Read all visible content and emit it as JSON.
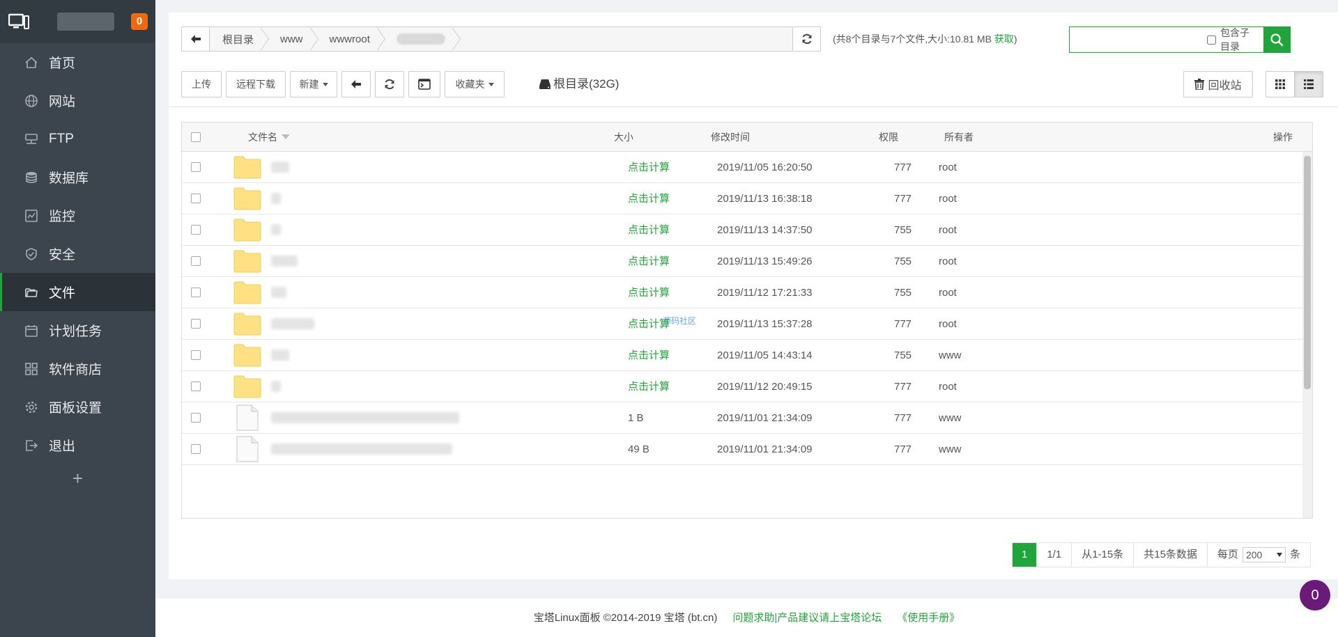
{
  "sidebar": {
    "badge": "0",
    "items": [
      {
        "label": "首页",
        "icon": "home-icon"
      },
      {
        "label": "网站",
        "icon": "globe-icon"
      },
      {
        "label": "FTP",
        "icon": "ftp-icon"
      },
      {
        "label": "数据库",
        "icon": "database-icon"
      },
      {
        "label": "监控",
        "icon": "monitor-icon"
      },
      {
        "label": "安全",
        "icon": "shield-icon"
      },
      {
        "label": "文件",
        "icon": "folder-icon",
        "active": true
      },
      {
        "label": "计划任务",
        "icon": "calendar-icon"
      },
      {
        "label": "软件商店",
        "icon": "grid-icon"
      },
      {
        "label": "面板设置",
        "icon": "gear-icon"
      },
      {
        "label": "退出",
        "icon": "logout-icon"
      }
    ],
    "add": "+"
  },
  "path": {
    "crumbs": [
      "根目录",
      "www",
      "wwwroot"
    ],
    "info_prefix": "(共8个目录与7个文件,大小:10.81 MB ",
    "info_link": "获取",
    "info_suffix": ")"
  },
  "search": {
    "placeholder": "",
    "subdir_label": "包含子目录"
  },
  "toolbar": {
    "upload": "上传",
    "remote_download": "远程下载",
    "new": "新建",
    "favorites": "收藏夹",
    "disk": "根目录(32G)",
    "recycle": "回收站"
  },
  "table": {
    "headers": {
      "name": "文件名",
      "size": "大小",
      "mtime": "修改时间",
      "perm": "权限",
      "owner": "所有者",
      "ops": "操作"
    },
    "rows": [
      {
        "type": "folder",
        "size": "点击计算",
        "mtime": "2019/11/05 16:20:50",
        "perm": "777",
        "owner": "root"
      },
      {
        "type": "folder",
        "size": "点击计算",
        "mtime": "2019/11/13 16:38:18",
        "perm": "777",
        "owner": "root"
      },
      {
        "type": "folder",
        "size": "点击计算",
        "mtime": "2019/11/13 14:37:50",
        "perm": "755",
        "owner": "root"
      },
      {
        "type": "folder",
        "size": "点击计算",
        "mtime": "2019/11/13 15:49:26",
        "perm": "755",
        "owner": "root"
      },
      {
        "type": "folder",
        "size": "点击计算",
        "mtime": "2019/11/12 17:21:33",
        "perm": "755",
        "owner": "root"
      },
      {
        "type": "folder",
        "size": "点击计算",
        "mtime": "2019/11/13 15:37:28",
        "perm": "777",
        "owner": "root"
      },
      {
        "type": "folder",
        "size": "点击计算",
        "mtime": "2019/11/05 14:43:14",
        "perm": "755",
        "owner": "www"
      },
      {
        "type": "folder",
        "size": "点击计算",
        "mtime": "2019/11/12 20:49:15",
        "perm": "777",
        "owner": "root"
      },
      {
        "type": "file",
        "size": "1 B",
        "mtime": "2019/11/01 21:34:09",
        "perm": "777",
        "owner": "www"
      },
      {
        "type": "file",
        "size": "49 B",
        "mtime": "2019/11/01 21:34:09",
        "perm": "777",
        "owner": "www"
      }
    ],
    "watermark": "源码社区"
  },
  "pager": {
    "current": "1",
    "pages": "1/1",
    "range": "从1-15条",
    "total": "共15条数据",
    "per_label": "每页",
    "per_value": "200",
    "per_unit": "条"
  },
  "footer": {
    "copyright": "宝塔Linux面板 ©2014-2019 宝塔 (bt.cn)",
    "forum": "问题求助|产品建议请上宝塔论坛",
    "manual": "《使用手册》"
  },
  "float_badge": "0",
  "colors": {
    "accent": "#20a53a",
    "sidebar": "#3c444d",
    "badge": "#f0690f"
  }
}
